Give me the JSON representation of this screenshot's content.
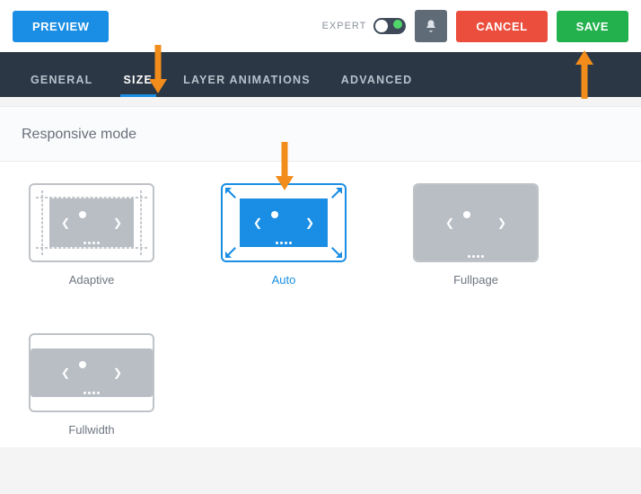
{
  "topbar": {
    "preview_label": "PREVIEW",
    "expert_label": "EXPERT",
    "cancel_label": "CANCEL",
    "save_label": "SAVE"
  },
  "tabs": {
    "general": "GENERAL",
    "size": "SIZE",
    "layer_animations": "LAYER ANIMATIONS",
    "advanced": "ADVANCED",
    "active": "size"
  },
  "section": {
    "responsive_mode_title": "Responsive mode"
  },
  "options": {
    "adaptive": "Adaptive",
    "auto": "Auto",
    "fullpage": "Fullpage",
    "fullwidth": "Fullwidth",
    "selected": "auto"
  },
  "colors": {
    "primary": "#1a8ee4",
    "save": "#23b14d",
    "cancel": "#eb4e3d",
    "annotation_arrow": "#f28c1b"
  }
}
